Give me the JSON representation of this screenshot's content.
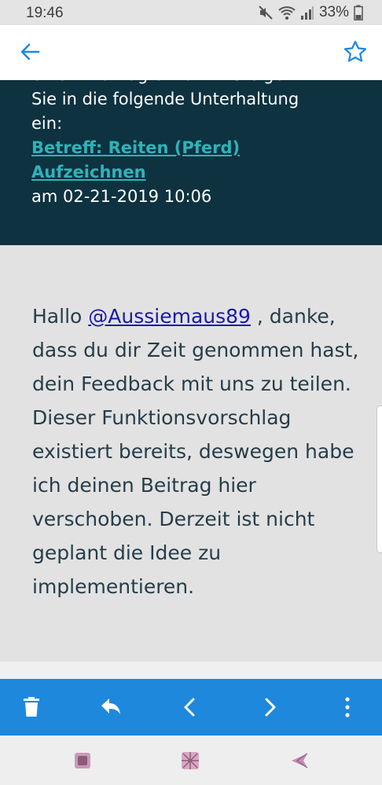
{
  "status": {
    "time": "19:46",
    "battery": "33%"
  },
  "header": {
    "back_icon": "arrow-left-icon",
    "star_icon": "star-outline-icon"
  },
  "notice": {
    "line_partial": "einem Beitrag erwähnt. Steigen",
    "line_2": "Sie in die folgende Unterhaltung",
    "line_3": "ein:",
    "link_line_1": "Betreff: Reiten (Pferd)",
    "link_line_2": "Aufzeichnen",
    "date": "am 02-21-2019 10:06"
  },
  "message": {
    "greeting": "Hallo ",
    "mention": "@Aussiemaus89",
    "body": " , danke, dass du dir Zeit genommen hast, dein Feedback mit uns zu teilen. Dieser Funktionsvorschlag existiert bereits, deswegen habe ich deinen Beitrag hier verschoben. Derzeit ist nicht geplant die Idee zu implementieren."
  },
  "toolbar": {
    "icons": [
      "trash-icon",
      "reply-icon",
      "chevron-left-icon",
      "chevron-right-icon",
      "more-vertical-icon"
    ]
  },
  "colors": {
    "accent": "#1e88dc",
    "dark_panel": "#0e3240",
    "link_teal": "#2fb3b8",
    "mention_link": "#1a1aa8"
  }
}
